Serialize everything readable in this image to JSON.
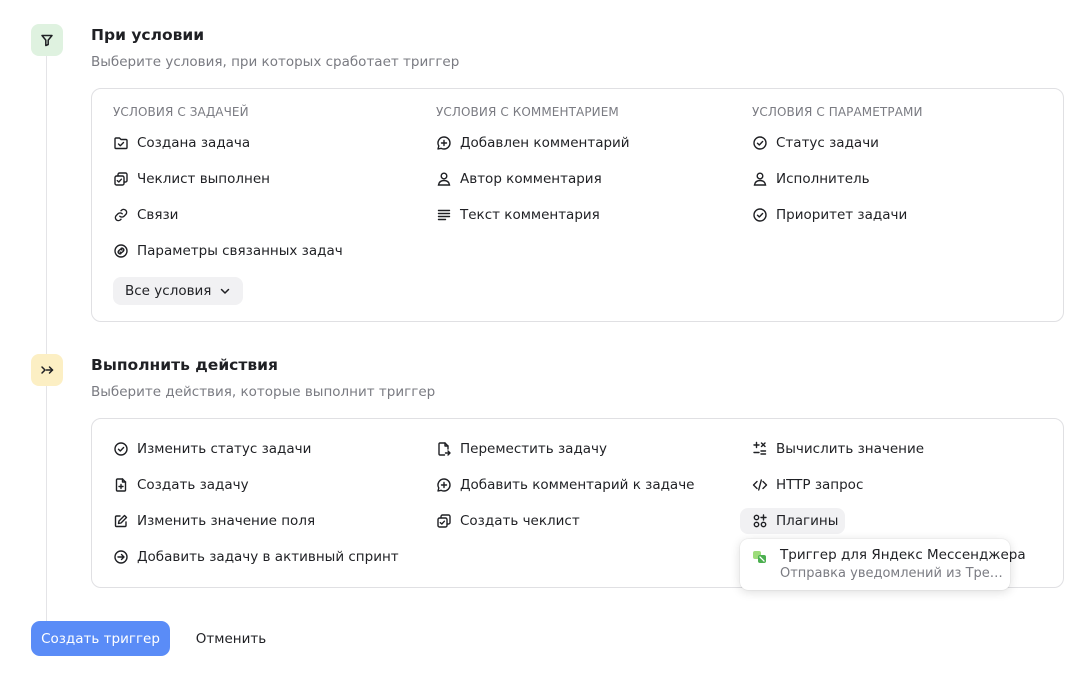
{
  "conditions": {
    "title": "При условии",
    "subtitle": "Выберите условия, при которых сработает триггер",
    "columns": [
      {
        "header": "УСЛОВИЯ С ЗАДАЧЕЙ",
        "items": [
          {
            "label": "Создана задача",
            "icon": "task-created-icon"
          },
          {
            "label": "Чеклист выполнен",
            "icon": "checklist-icon"
          },
          {
            "label": "Связи",
            "icon": "link-icon"
          },
          {
            "label": "Параметры связанных задач",
            "icon": "linked-params-icon"
          }
        ]
      },
      {
        "header": "УСЛОВИЯ С КОММЕНТАРИЕМ",
        "items": [
          {
            "label": "Добавлен комментарий",
            "icon": "comment-add-icon"
          },
          {
            "label": "Автор комментария",
            "icon": "person-icon"
          },
          {
            "label": "Текст комментария",
            "icon": "text-lines-icon"
          }
        ]
      },
      {
        "header": "УСЛОВИЯ С ПАРАМЕТРАМИ",
        "items": [
          {
            "label": "Статус задачи",
            "icon": "check-circle-icon"
          },
          {
            "label": "Исполнитель",
            "icon": "person-icon"
          },
          {
            "label": "Приоритет задачи",
            "icon": "check-circle-icon"
          }
        ]
      }
    ],
    "all_conditions_label": "Все условия"
  },
  "actions": {
    "title": "Выполнить действия",
    "subtitle": "Выберите действия, которые выполнит триггер",
    "columns": [
      {
        "items": [
          {
            "label": "Изменить статус задачи",
            "icon": "check-circle-icon"
          },
          {
            "label": "Создать задачу",
            "icon": "file-plus-icon"
          },
          {
            "label": "Изменить значение поля",
            "icon": "edit-icon"
          },
          {
            "label": "Добавить задачу в активный спринт",
            "icon": "arrow-circle-icon"
          }
        ]
      },
      {
        "items": [
          {
            "label": "Переместить задачу",
            "icon": "file-move-icon"
          },
          {
            "label": "Добавить комментарий к задаче",
            "icon": "comment-add-icon"
          },
          {
            "label": "Создать чеклист",
            "icon": "checklist-icon"
          }
        ]
      },
      {
        "items": [
          {
            "label": "Вычислить значение",
            "icon": "calculator-icon"
          },
          {
            "label": "HTTP запрос",
            "icon": "code-icon"
          }
        ]
      }
    ],
    "plugins_label": "Плагины",
    "plugin_popup": {
      "title": "Триггер для Яндекс Мессенджера",
      "description": "Отправка уведомлений из Трекера в Яндекс Мессенджер",
      "icon": "messenger-plugin-icon"
    }
  },
  "footer": {
    "create_label": "Создать триггер",
    "cancel_label": "Отменить"
  },
  "colors": {
    "primary": "#5a8cf7",
    "condition_badge": "#dff2e0",
    "action_badge": "#fcefc4"
  }
}
